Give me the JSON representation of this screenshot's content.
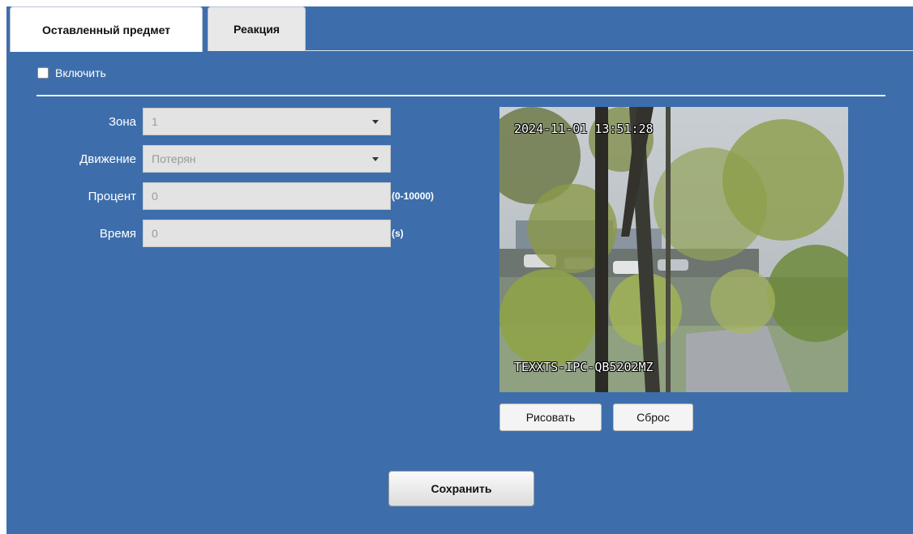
{
  "tabs": {
    "left_object": "Оставленный предмет",
    "reaction": "Реакция"
  },
  "enable": {
    "label": "Включить",
    "checked": false
  },
  "form": {
    "zone_label": "Зона",
    "zone_value": "1",
    "motion_label": "Движение",
    "motion_value": "Потерян",
    "percent_label": "Процент",
    "percent_value": "0",
    "percent_hint": "(0-10000)",
    "time_label": "Время",
    "time_value": "0",
    "time_hint": "(s)"
  },
  "video": {
    "timestamp": "2024-11-01 13:51:28",
    "camera_name": "TEXXTS-IPC-QB5202MZ"
  },
  "buttons": {
    "draw": "Рисовать",
    "reset": "Сброс",
    "save": "Сохранить"
  },
  "colors": {
    "panel_bg": "#3d6eab",
    "field_bg": "#e3e3e3"
  }
}
